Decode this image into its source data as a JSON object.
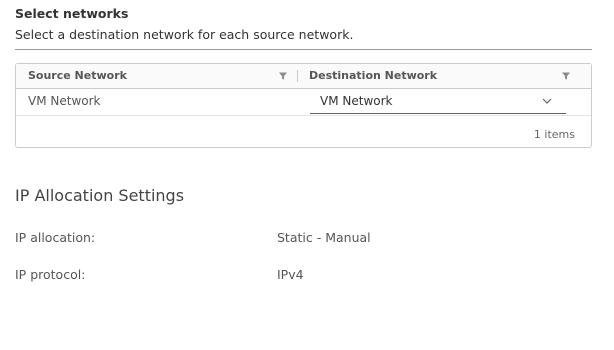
{
  "networks": {
    "title": "Select networks",
    "description": "Select a destination network for each source network.",
    "grid": {
      "columns": [
        "Source Network",
        "Destination Network"
      ],
      "rows": [
        {
          "source": "VM Network",
          "destination": "VM Network"
        }
      ],
      "footer": "1 items"
    }
  },
  "ip_allocation": {
    "title": "IP Allocation Settings",
    "fields": [
      {
        "label": "IP allocation:",
        "value": "Static - Manual"
      },
      {
        "label": "IP protocol:",
        "value": "IPv4"
      }
    ]
  },
  "icons": {
    "filter": "filter-icon",
    "dropdown": "chevron-down-icon"
  }
}
